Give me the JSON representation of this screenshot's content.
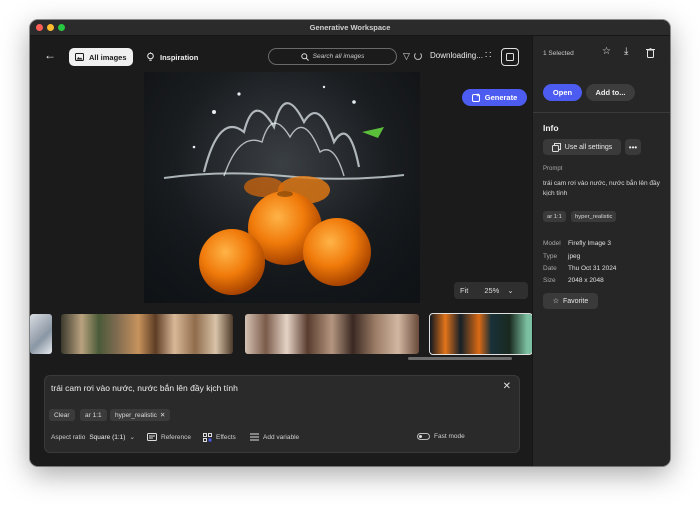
{
  "window": {
    "title": "Generative Workspace"
  },
  "topbar": {
    "all_images_label": "All images",
    "inspiration_label": "Inspiration",
    "search_placeholder": "Search all images",
    "status_text": "Downloading..."
  },
  "viewer": {
    "fit_label": "Fit",
    "zoom_level": "25%"
  },
  "prompt_box": {
    "text": "trái cam rơi vào nước, nước bắn lên đầy kịch tính",
    "clear_label": "Clear",
    "chips": [
      "ar 1:1",
      "hyper_realistic"
    ],
    "aspect_ratio_label": "Aspect ratio",
    "aspect_ratio_value": "Square (1:1)",
    "reference_label": "Reference",
    "effects_label": "Effects",
    "add_variable_label": "Add variable",
    "fast_mode_label": "Fast mode",
    "generate_label": "Generate"
  },
  "panel": {
    "selected_count": "1 Selected",
    "open_label": "Open",
    "add_to_label": "Add to...",
    "info_heading": "Info",
    "use_all_settings_label": "Use all settings",
    "prompt_label": "Prompt",
    "prompt_value": "trái cam rơi vào nước, nước bắn lên đầy kịch tính",
    "tags": [
      "ar 1:1",
      "hyper_realistic"
    ],
    "meta": [
      {
        "key": "Model",
        "value": "Firefly Image 3"
      },
      {
        "key": "Type",
        "value": "jpeg"
      },
      {
        "key": "Date",
        "value": "Thu Oct 31 2024"
      },
      {
        "key": "Size",
        "value": "2048 x 2048"
      }
    ],
    "favorite_label": "Favorite"
  },
  "colors": {
    "accent": "#4d5cf0",
    "background": "#1b1b1b",
    "panel": "#262626"
  },
  "icons": [
    "back-arrow-icon",
    "image-icon",
    "lightbulb-icon",
    "search-icon",
    "filter-icon",
    "spinner-icon",
    "grid-icon",
    "square-icon",
    "star-icon",
    "download-icon",
    "trash-icon",
    "close-icon",
    "chevron-down-icon",
    "reference-icon",
    "effects-icon",
    "variable-icon",
    "generate-icon",
    "settings-icon",
    "more-icon"
  ]
}
